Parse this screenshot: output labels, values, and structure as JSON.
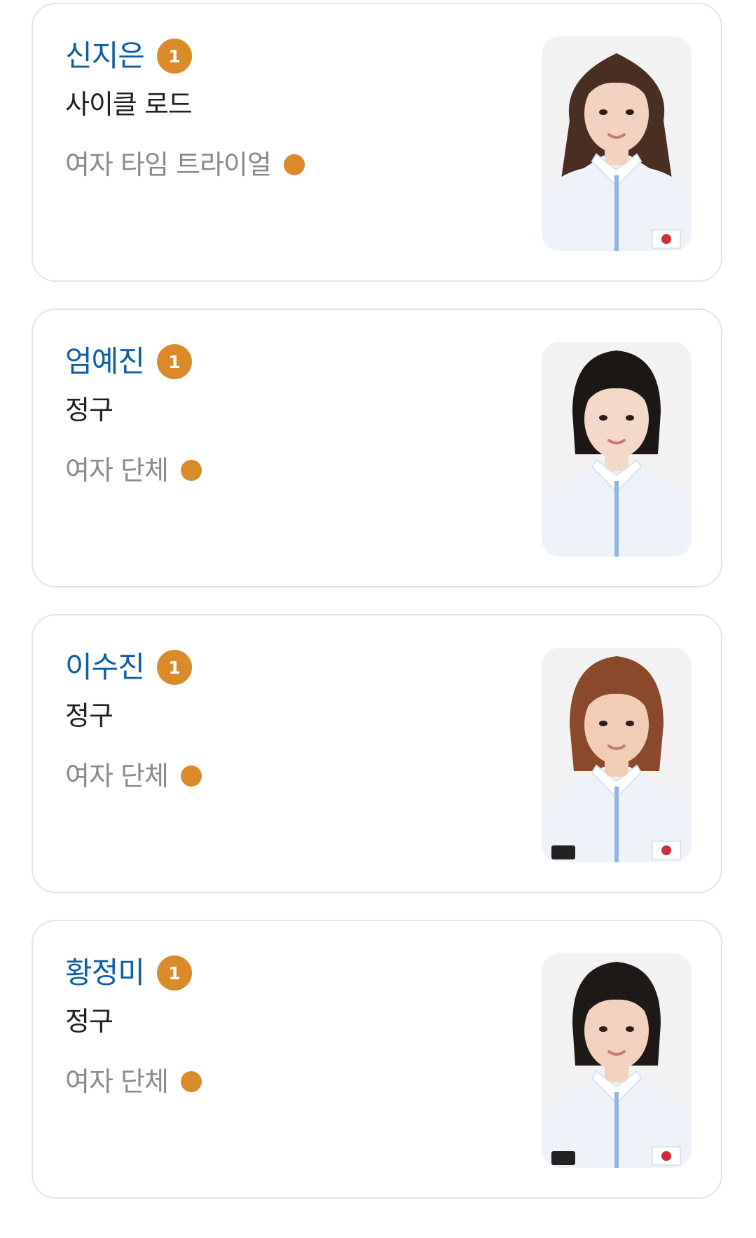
{
  "athletes": [
    {
      "name": "신지은",
      "rank": "1",
      "sport": "사이클 로드",
      "event": "여자 타임 트라이얼",
      "hair_color": "#4a2e22",
      "hair_style": "long",
      "skin_color": "#f3d3bf",
      "flag_visible": true,
      "logo_visible": false
    },
    {
      "name": "엄예진",
      "rank": "1",
      "sport": "정구",
      "event": "여자 단체",
      "hair_color": "#1c1715",
      "hair_style": "bob",
      "skin_color": "#f4d8c8",
      "flag_visible": false,
      "logo_visible": false
    },
    {
      "name": "이수진",
      "rank": "1",
      "sport": "정구",
      "event": "여자 단체",
      "hair_color": "#8a4a2a",
      "hair_style": "medium",
      "skin_color": "#f1cdb4",
      "flag_visible": true,
      "logo_visible": true
    },
    {
      "name": "황정미",
      "rank": "1",
      "sport": "정구",
      "event": "여자 단체",
      "hair_color": "#1e1917",
      "hair_style": "bob",
      "skin_color": "#f2d2bf",
      "flag_visible": true,
      "logo_visible": true
    }
  ],
  "colors": {
    "name": "#0d5ea4",
    "medal": "#db8a2a",
    "event": "#8a8a8a",
    "card_border": "#e4e4e4",
    "jacket": "#eef3fa",
    "zipper": "#8fb6e0"
  }
}
